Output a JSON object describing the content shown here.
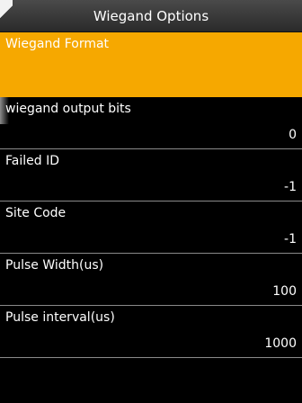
{
  "header": {
    "title": "Wiegand Options"
  },
  "menu": {
    "items": [
      {
        "label": "Wiegand Format",
        "value": ""
      },
      {
        "label": "wiegand output bits",
        "value": "0"
      },
      {
        "label": "Failed ID",
        "value": "-1"
      },
      {
        "label": "Site Code",
        "value": "-1"
      },
      {
        "label": "Pulse Width(us)",
        "value": "100"
      },
      {
        "label": "Pulse interval(us)",
        "value": "1000"
      }
    ]
  },
  "colors": {
    "selected_background": "#f6a800",
    "background": "#000000",
    "text": "#ffffff"
  }
}
